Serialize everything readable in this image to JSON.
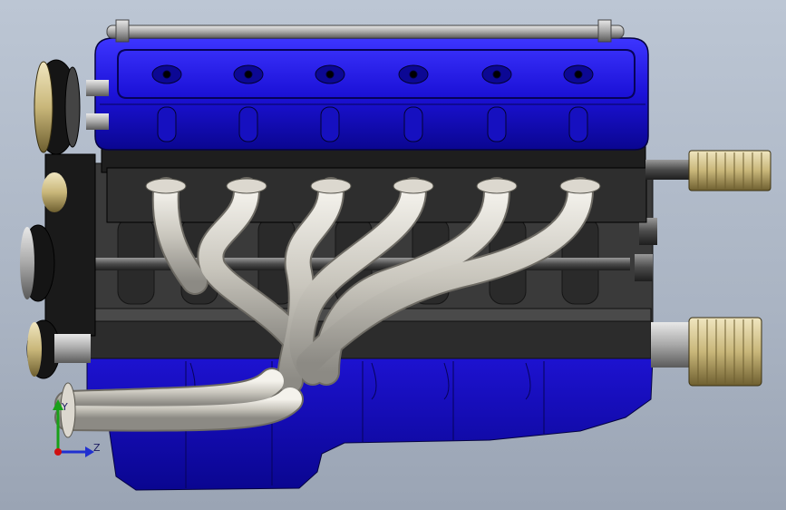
{
  "viewport": {
    "background": "#aab4c3",
    "colors": {
      "block_blue": "#1a0fd6",
      "block_dark_blue": "#0b0680",
      "valve_cover_blue": "#2a22e8",
      "block_charcoal": "#3a3a3a",
      "header_silver": "#d7d4cc",
      "pulley_black": "#151515",
      "filter_brass": "#c9b77a"
    }
  },
  "model": {
    "parts": [
      {
        "name": "valve-cover",
        "color": "valve_cover_blue"
      },
      {
        "name": "cylinder-head",
        "color": "block_charcoal"
      },
      {
        "name": "engine-block",
        "color": "block_charcoal"
      },
      {
        "name": "oil-pan",
        "color": "block_blue"
      },
      {
        "name": "exhaust-header",
        "color": "header_silver",
        "runners": 6
      },
      {
        "name": "pulley-stack",
        "color": "pulley_black"
      },
      {
        "name": "oil-filter",
        "color": "filter_brass",
        "count": 2
      }
    ]
  },
  "triad": {
    "labels": {
      "y": "Y",
      "z": "Z"
    },
    "colors": {
      "y": "#18a018",
      "z": "#2030d0",
      "origin": "#d01010"
    }
  }
}
